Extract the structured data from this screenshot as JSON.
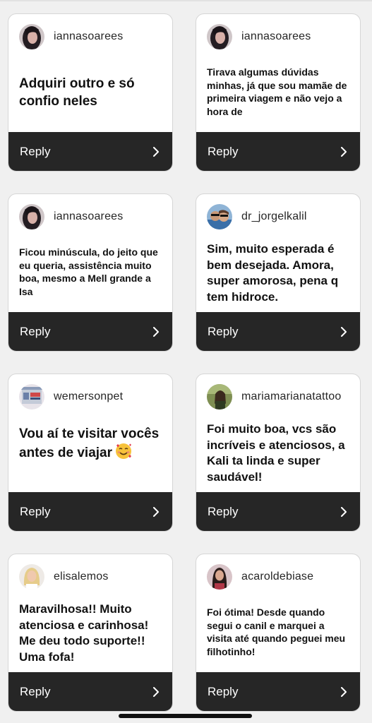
{
  "reply_label": "Reply",
  "colors": {
    "reply_bar": "#262626",
    "card_bg": "#ffffff",
    "text": "#111111"
  },
  "cards": [
    {
      "username": "iannasoarees",
      "comment": "Adquiri outro e só confio neles",
      "avatar": "woman-dark-hair-avatar"
    },
    {
      "username": "iannasoarees",
      "comment": "Tirava algumas dúvidas minhas, já que sou mamãe de primeira viagem e não vejo a hora de",
      "avatar": "woman-dark-hair-avatar"
    },
    {
      "username": "iannasoarees",
      "comment": "Ficou minúscula, do jeito que eu queria, assistência muito boa, mesmo a Mell grande a Isa",
      "avatar": "woman-dark-hair-avatar"
    },
    {
      "username": "dr_jorgelkalil",
      "comment": "Sim, muito esperada é bem desejada. Amora, super amorosa, pena q tem hidroce.",
      "avatar": "couple-sunglasses-avatar"
    },
    {
      "username": "wemersonpet",
      "comment": "Vou aí te visitar vocês antes  de viajar",
      "emoji": "smiling-face-with-hearts",
      "avatar": "storefront-avatar"
    },
    {
      "username": "mariamarianatattoo",
      "comment": "Foi muito boa, vcs são incríveis e atenciosos, a Kali ta linda e super saudável!",
      "avatar": "woman-outdoors-avatar"
    },
    {
      "username": "elisalemos",
      "comment": "Maravilhosa!! Muito atenciosa e carinhosa! Me deu todo suporte!! Uma fofa!",
      "avatar": "blonde-woman-avatar"
    },
    {
      "username": "acaroldebiase",
      "comment": "Foi ótima! Desde quando segui o canil e marquei a visita até quando peguei meu filhotinho!",
      "avatar": "woman-long-hair-avatar"
    }
  ]
}
